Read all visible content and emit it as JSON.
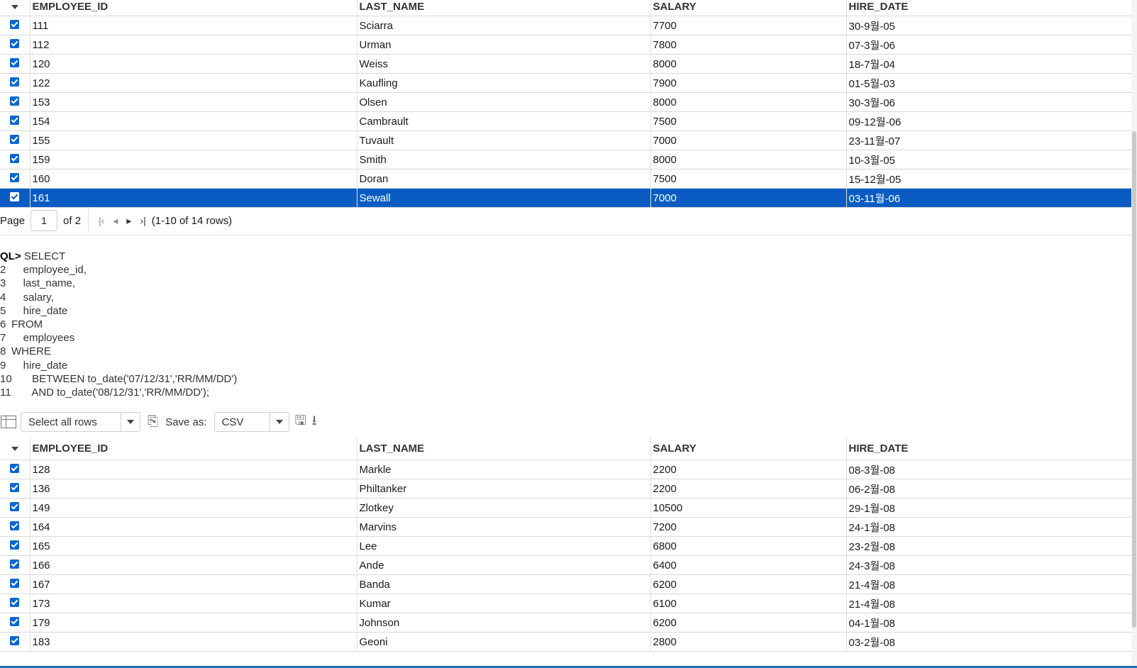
{
  "top_grid": {
    "headers": [
      "EMPLOYEE_ID",
      "LAST_NAME",
      "SALARY",
      "HIRE_DATE"
    ],
    "rows": [
      {
        "id": "111",
        "last_name": "Sciarra",
        "salary": "7700",
        "hire_date": "30-9월-05"
      },
      {
        "id": "112",
        "last_name": "Urman",
        "salary": "7800",
        "hire_date": "07-3월-06"
      },
      {
        "id": "120",
        "last_name": "Weiss",
        "salary": "8000",
        "hire_date": "18-7월-04"
      },
      {
        "id": "122",
        "last_name": "Kaufling",
        "salary": "7900",
        "hire_date": "01-5월-03"
      },
      {
        "id": "153",
        "last_name": "Olsen",
        "salary": "8000",
        "hire_date": "30-3월-06"
      },
      {
        "id": "154",
        "last_name": "Cambrault",
        "salary": "7500",
        "hire_date": "09-12월-06"
      },
      {
        "id": "155",
        "last_name": "Tuvault",
        "salary": "7000",
        "hire_date": "23-11월-07"
      },
      {
        "id": "159",
        "last_name": "Smith",
        "salary": "8000",
        "hire_date": "10-3월-05"
      },
      {
        "id": "160",
        "last_name": "Doran",
        "salary": "7500",
        "hire_date": "15-12월-05"
      },
      {
        "id": "161",
        "last_name": "Sewall",
        "salary": "7000",
        "hire_date": "03-11월-06",
        "selected": true
      }
    ]
  },
  "pager": {
    "page_label": "Page",
    "page_value": "1",
    "of_label": "of 2",
    "first_icon": "first-page-icon",
    "prev_icon": "prev-page-icon",
    "next_icon": "next-page-icon",
    "last_icon": "last-page-icon",
    "range_text": "(1-10 of 14 rows)"
  },
  "sql": {
    "prompt": "QL>",
    "first_line": "SELECT",
    "lines": [
      {
        "n": "2",
        "text": "    employee_id,"
      },
      {
        "n": "3",
        "text": "    last_name,"
      },
      {
        "n": "4",
        "text": "    salary,"
      },
      {
        "n": "5",
        "text": "    hire_date"
      },
      {
        "n": "6",
        "text": "FROM"
      },
      {
        "n": "7",
        "text": "    employees"
      },
      {
        "n": "8",
        "text": "WHERE"
      },
      {
        "n": "9",
        "text": "    hire_date"
      },
      {
        "n": "10",
        "text": "       BETWEEN to_date('07/12/31','RR/MM/DD')"
      },
      {
        "n": "11",
        "text": "       AND to_date('08/12/31','RR/MM/DD');"
      }
    ]
  },
  "toolbar": {
    "grid_icon": "grid-toggle-icon",
    "select_rows_value": "Select all rows",
    "copy_icon": "copy-icon",
    "save_as_label": "Save as:",
    "format_value": "CSV",
    "save_icon": "save-icon",
    "download_icon": "download-icon"
  },
  "bottom_grid": {
    "headers": [
      "EMPLOYEE_ID",
      "LAST_NAME",
      "SALARY",
      "HIRE_DATE"
    ],
    "rows": [
      {
        "id": "128",
        "last_name": "Markle",
        "salary": "2200",
        "hire_date": "08-3월-08"
      },
      {
        "id": "136",
        "last_name": "Philtanker",
        "salary": "2200",
        "hire_date": "06-2월-08"
      },
      {
        "id": "149",
        "last_name": "Zlotkey",
        "salary": "10500",
        "hire_date": "29-1월-08"
      },
      {
        "id": "164",
        "last_name": "Marvins",
        "salary": "7200",
        "hire_date": "24-1월-08"
      },
      {
        "id": "165",
        "last_name": "Lee",
        "salary": "6800",
        "hire_date": "23-2월-08"
      },
      {
        "id": "166",
        "last_name": "Ande",
        "salary": "6400",
        "hire_date": "24-3월-08"
      },
      {
        "id": "167",
        "last_name": "Banda",
        "salary": "6200",
        "hire_date": "21-4월-08"
      },
      {
        "id": "173",
        "last_name": "Kumar",
        "salary": "6100",
        "hire_date": "21-4월-08"
      },
      {
        "id": "179",
        "last_name": "Johnson",
        "salary": "6200",
        "hire_date": "04-1월-08"
      },
      {
        "id": "183",
        "last_name": "Geoni",
        "salary": "2800",
        "hire_date": "03-2월-08"
      }
    ]
  },
  "colors": {
    "selection": "#0a5cc2",
    "checkbox": "#0a66d0"
  }
}
